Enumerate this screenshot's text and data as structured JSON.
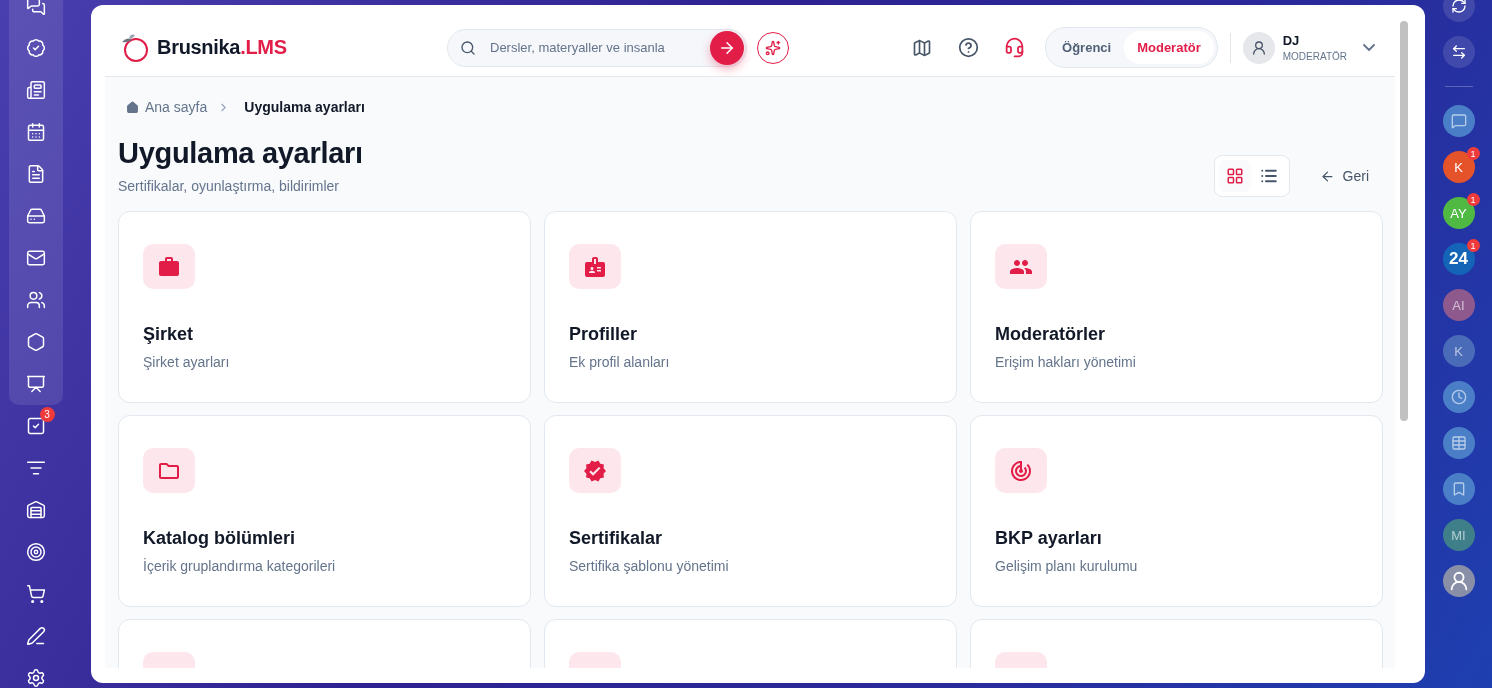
{
  "left_rail": {
    "items": [
      {
        "kind": "chat"
      },
      {
        "kind": "sparkle-badge"
      },
      {
        "kind": "newspaper"
      },
      {
        "kind": "calendar"
      },
      {
        "kind": "document"
      },
      {
        "kind": "drive"
      },
      {
        "kind": "mail"
      },
      {
        "kind": "users"
      },
      {
        "kind": "hexagon"
      },
      {
        "kind": "presentation"
      },
      {
        "kind": "task",
        "badge": "3"
      },
      {
        "kind": "funnel"
      },
      {
        "kind": "warehouse"
      },
      {
        "kind": "target"
      },
      {
        "kind": "cart"
      },
      {
        "kind": "signature"
      },
      {
        "kind": "settings"
      }
    ]
  },
  "header": {
    "logo": {
      "name": "Brusnika",
      "suffix": ".LMS"
    },
    "search": {
      "placeholder": "Dersler, materyaller ve insanla"
    },
    "roles": [
      {
        "label": "Öğrenci",
        "selected": false
      },
      {
        "label": "Moderatör",
        "selected": true
      }
    ],
    "user": {
      "name": "DJ",
      "role": "MODERATÖR"
    }
  },
  "breadcrumb": [
    "Ana sayfa",
    "Uygulama ayarları"
  ],
  "page": {
    "title": "Uygulama ayarları",
    "subtitle": "Sertifikalar, oyunlaştırma, bildirimler",
    "views": [
      {
        "kind": "grid",
        "selected": true
      },
      {
        "kind": "list",
        "selected": false
      }
    ],
    "back": "Geri"
  },
  "cards": [
    {
      "kind": "briefcase",
      "title": "Şirket",
      "description": "Şirket ayarları"
    },
    {
      "kind": "id-badge",
      "title": "Profiller",
      "description": "Ek profil alanları"
    },
    {
      "kind": "people",
      "title": "Moderatörler",
      "description": "Erişim hakları yönetimi"
    },
    {
      "kind": "folder",
      "title": "Katalog bölümleri",
      "description": "İçerik gruplandırma kategorileri"
    },
    {
      "kind": "verified",
      "title": "Sertifikalar",
      "description": "Sertifika şablonu yönetimi"
    },
    {
      "kind": "target",
      "title": "BKP ayarları",
      "description": "Gelişim planı kurulumu"
    },
    {
      "kind": "partial"
    },
    {
      "kind": "partial"
    },
    {
      "kind": "partial"
    }
  ],
  "right_rail": {
    "items": [
      {
        "kind": "refresh"
      },
      {
        "kind": "swap"
      },
      {
        "kind": "divider"
      },
      {
        "kind": "chat",
        "dimmed": true
      },
      {
        "kind": "initials",
        "label": "K",
        "color": "#e5532b",
        "badge": "1",
        "dimmed": false
      },
      {
        "kind": "initials",
        "label": "AY",
        "color": "#4fb944",
        "badge": "1",
        "dimmed": false
      },
      {
        "kind": "initials",
        "label": "24",
        "color": "#1465b8",
        "badge": "1",
        "dimmed": false
      },
      {
        "kind": "initials",
        "label": "AI",
        "color": "#8e5a8e",
        "dimmed": true
      },
      {
        "kind": "initials",
        "label": "K",
        "color": "#4a6bb8",
        "dimmed": true
      },
      {
        "kind": "contact-clock",
        "dimmed": true
      },
      {
        "kind": "table",
        "dimmed": true
      },
      {
        "kind": "bookmark",
        "dimmed": true
      },
      {
        "kind": "initials",
        "label": "MI",
        "color": "#3f7f8a",
        "dimmed": true
      },
      {
        "kind": "avatar"
      }
    ]
  }
}
